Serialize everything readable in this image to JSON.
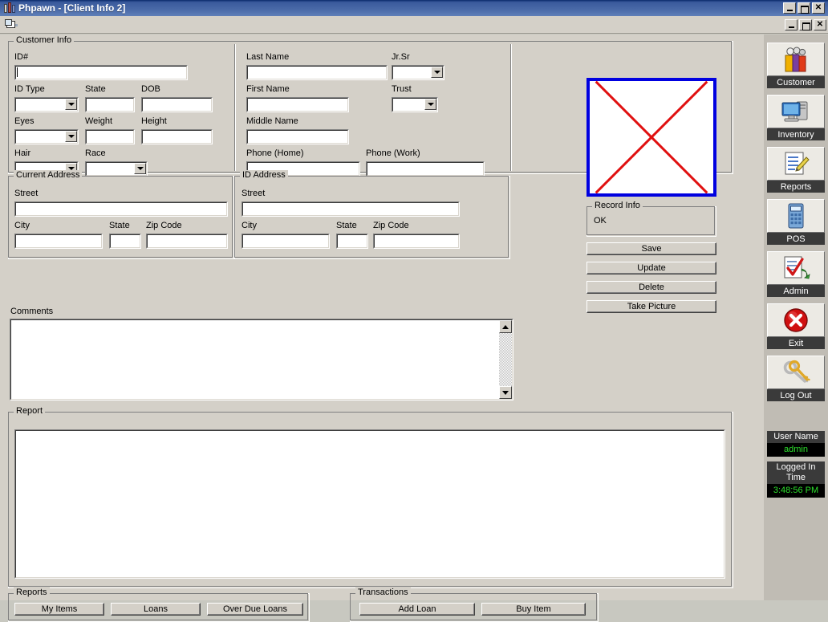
{
  "window": {
    "title": "Phpawn - [Client Info 2]",
    "app_icon": "app-icon",
    "toolbar_icon": "open-folder-icon",
    "minimize_label": "_",
    "maximize_label": "□",
    "close_label": "✕"
  },
  "customer_info": {
    "legend": "Customer Info",
    "left": {
      "id_number_label": "ID#",
      "id_number_value": "",
      "id_type_label": "ID Type",
      "id_type_value": "",
      "state_label": "State",
      "state_value": "",
      "dob_label": "DOB",
      "dob_value": "",
      "eyes_label": "Eyes",
      "eyes_value": "",
      "weight_label": "Weight",
      "weight_value": "",
      "height_label": "Height",
      "height_value": "",
      "hair_label": "Hair",
      "hair_value": "",
      "race_label": "Race",
      "race_value": ""
    },
    "right": {
      "last_name_label": "Last Name",
      "last_name_value": "",
      "jr_sr_label": "Jr.Sr",
      "jr_sr_value": "",
      "first_name_label": "First Name",
      "first_name_value": "",
      "trust_label": "Trust",
      "trust_value": "",
      "middle_name_label": "Middle Name",
      "middle_name_value": "",
      "phone_home_label": "Phone (Home)",
      "phone_home_value": "",
      "phone_work_label": "Phone (Work)",
      "phone_work_value": ""
    }
  },
  "current_address": {
    "legend": "Current Address",
    "street_label": "Street",
    "street_value": "",
    "city_label": "City",
    "city_value": "",
    "state_label": "State",
    "state_value": "",
    "zip_label": "Zip Code",
    "zip_value": ""
  },
  "id_address": {
    "legend": "ID Address",
    "street_label": "Street",
    "street_value": "",
    "city_label": "City",
    "city_value": "",
    "state_label": "State",
    "state_value": "",
    "zip_label": "Zip Code",
    "zip_value": ""
  },
  "photo": {
    "name": "broken-image-placeholder",
    "border_color": "#0000e0",
    "x_color": "#e01010"
  },
  "record_info": {
    "legend": "Record Info",
    "status": "OK"
  },
  "actions": {
    "save": "Save",
    "update": "Update",
    "delete": "Delete",
    "take_picture": "Take Picture"
  },
  "comments": {
    "label": "Comments",
    "value": ""
  },
  "report": {
    "legend": "Report",
    "value": ""
  },
  "reports_group": {
    "legend": "Reports",
    "buttons": [
      {
        "label": "My Items",
        "name": "my-items-button"
      },
      {
        "label": "Loans",
        "name": "loans-button"
      },
      {
        "label": "Over Due Loans",
        "name": "over-due-loans-button"
      }
    ]
  },
  "transactions_group": {
    "legend": "Transactions",
    "buttons": [
      {
        "label": "Add Loan",
        "name": "add-loan-button"
      },
      {
        "label": "Buy Item",
        "name": "buy-item-button"
      }
    ]
  },
  "sidebar": {
    "items": [
      {
        "label": "Customer",
        "icon": "customer-people-icon"
      },
      {
        "label": "Inventory",
        "icon": "computer-icon"
      },
      {
        "label": "Reports",
        "icon": "document-pen-icon"
      },
      {
        "label": "POS",
        "icon": "calculator-icon"
      },
      {
        "label": "Admin",
        "icon": "checklist-icon"
      },
      {
        "label": "Exit",
        "icon": "red-x-circle-icon"
      },
      {
        "label": "Log Out",
        "icon": "keys-icon"
      }
    ],
    "user_name_label": "User Name",
    "user_name_value": "admin",
    "logged_in_label": "Logged In Time",
    "logged_in_value": "3:48:56 PM",
    "accent_green": "#2ce02c"
  }
}
